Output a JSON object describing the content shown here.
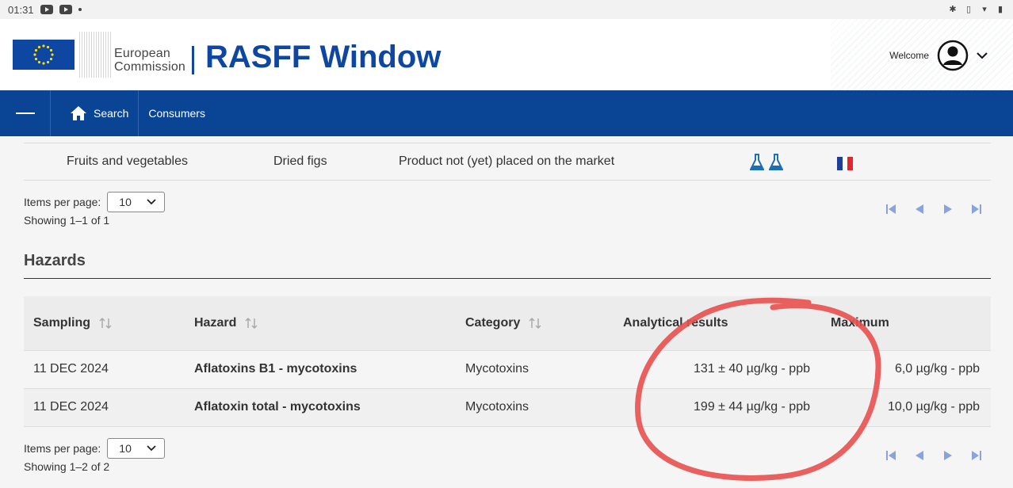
{
  "statusbar": {
    "time": "01:31"
  },
  "header": {
    "org_line1": "European",
    "org_line2": "Commission",
    "title": "RASFF Window",
    "welcome": "Welcome"
  },
  "nav": {
    "search": "Search",
    "consumers": "Consumers"
  },
  "product_row": {
    "category": "Fruits and vegetables",
    "product": "Dried figs",
    "distribution": "Product not (yet) placed on the market"
  },
  "pager1": {
    "items_per_page_label": "Items per page:",
    "items_per_page": "10",
    "showing": "Showing 1–1 of 1"
  },
  "hazards": {
    "title": "Hazards",
    "columns": [
      "Sampling",
      "Hazard",
      "Category",
      "Analytical results",
      "Maximum"
    ],
    "rows": [
      {
        "sampling": "11 DEC 2024",
        "hazard": "Aflatoxins B1 - mycotoxins",
        "category": "Mycotoxins",
        "result": "131 ± 40 µg/kg - ppb",
        "maximum": "6,0 µg/kg - ppb"
      },
      {
        "sampling": "11 DEC 2024",
        "hazard": "Aflatoxin total - mycotoxins",
        "category": "Mycotoxins",
        "result": "199 ± 44 µg/kg - ppb",
        "maximum": "10,0 µg/kg - ppb"
      }
    ]
  },
  "pager2": {
    "items_per_page_label": "Items per page:",
    "items_per_page": "10",
    "showing": "Showing 1–2 of 2"
  },
  "colors": {
    "brand_blue": "#0a4495",
    "annotation_red": "#e8504f"
  }
}
